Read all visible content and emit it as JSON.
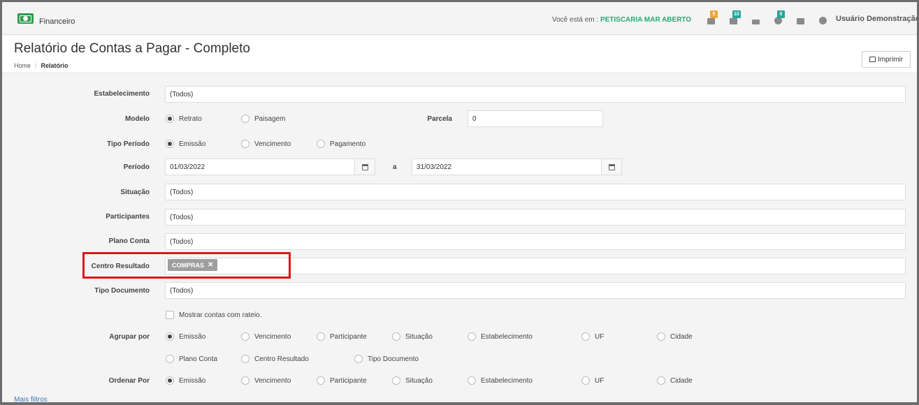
{
  "app": {
    "section_label": "Financeiro"
  },
  "topbar": {
    "location_prefix": "Você está em : ",
    "location_name": "PETISCARIA MAR ABERTO",
    "icons": [
      {
        "name": "sitemap-icon",
        "badge": "5",
        "badge_color": "#f0a53c"
      },
      {
        "name": "grid-icon",
        "badge": "10",
        "badge_color": "#26a69a"
      },
      {
        "name": "list-icon",
        "badge": "",
        "badge_color": ""
      },
      {
        "name": "bell-icon",
        "badge": "0",
        "badge_color": "#26a69a"
      },
      {
        "name": "calendar-icon",
        "badge": "",
        "badge_color": ""
      },
      {
        "name": "help-icon",
        "badge": "",
        "badge_color": ""
      }
    ],
    "user_name": "Usuário Demonstração"
  },
  "page": {
    "title": "Relatório de Contas a Pagar - Completo",
    "breadcrumb": {
      "home": "Home",
      "current": "Relatório"
    },
    "print_label": "Imprimir"
  },
  "form": {
    "estabelecimento": {
      "label": "Estabelecimento",
      "value": "(Todos)"
    },
    "modelo": {
      "label": "Modelo",
      "options": [
        "Retrato",
        "Paisagem"
      ],
      "selected": "Retrato"
    },
    "parcela": {
      "label": "Parcela",
      "value": "0"
    },
    "tipo_periodo": {
      "label": "Tipo Período",
      "options": [
        "Emissão",
        "Vencimento",
        "Pagamento"
      ],
      "selected": "Emissão"
    },
    "periodo": {
      "label": "Período",
      "start": "01/03/2022",
      "separator": "a",
      "end": "31/03/2022"
    },
    "situacao": {
      "label": "Situação",
      "value": "(Todos)"
    },
    "participantes": {
      "label": "Participantes",
      "value": "(Todos)"
    },
    "plano_conta": {
      "label": "Plano Conta",
      "value": "(Todos)"
    },
    "centro_resultado": {
      "label": "Centro Resultado",
      "tags": [
        "COMPRAS"
      ]
    },
    "tipo_documento": {
      "label": "Tipo Documento",
      "value": "(Todos)"
    },
    "rateio": {
      "label": "Mostrar contas com rateio.",
      "checked": false
    },
    "agrupar_por": {
      "label": "Agrupar por",
      "options": [
        "Emissão",
        "Vencimento",
        "Participante",
        "Situação",
        "Estabelecimento",
        "UF",
        "Cidade",
        "Plano Conta",
        "Centro Resultado",
        "Tipo Documento"
      ],
      "selected": "Emissão"
    },
    "ordenar_por": {
      "label": "Ordenar Por",
      "options": [
        "Emissão",
        "Vencimento",
        "Participante",
        "Situação",
        "Estabelecimento",
        "UF",
        "Cidade"
      ],
      "selected": "Emissão"
    },
    "more_filters": "Mais filtros"
  },
  "colors": {
    "accent_green": "#2aa876",
    "highlight_red": "#e0141c",
    "link_blue": "#3a78b6"
  }
}
